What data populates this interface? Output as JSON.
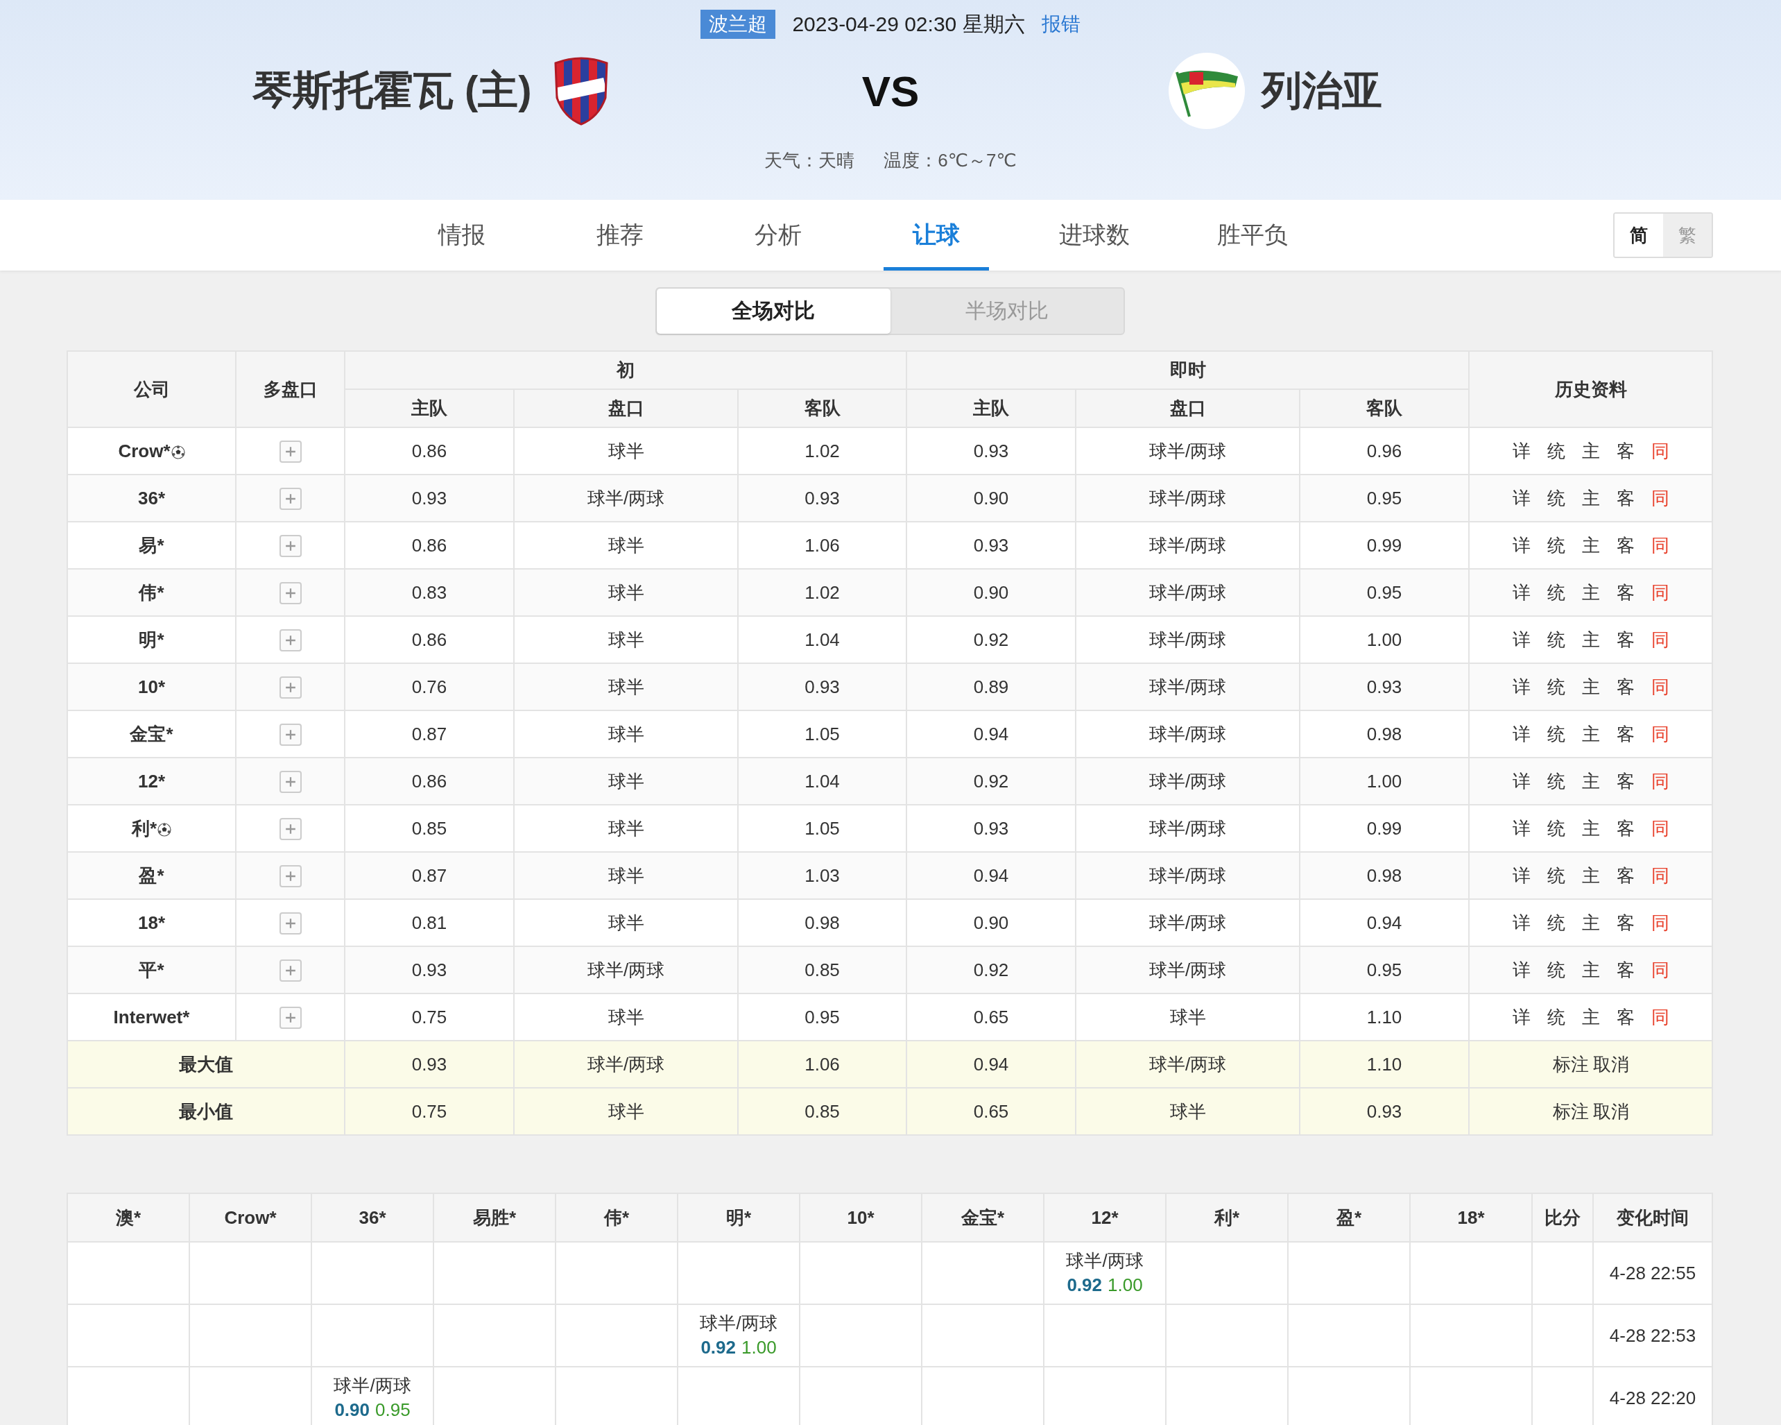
{
  "match": {
    "league": "波兰超",
    "datetime": "2023-04-29 02:30 星期六",
    "report_link": "报错",
    "home_team": "琴斯托霍瓦 (主)",
    "versus": "VS",
    "away_team": "列治亚",
    "weather": "天气：天晴",
    "temperature": "温度：6℃～7℃"
  },
  "tabs": [
    {
      "label": "情报",
      "selected": false
    },
    {
      "label": "推荐",
      "selected": false
    },
    {
      "label": "分析",
      "selected": false
    },
    {
      "label": "让球",
      "selected": true
    },
    {
      "label": "进球数",
      "selected": false
    },
    {
      "label": "胜平负",
      "selected": false
    }
  ],
  "script_toggle": [
    {
      "label": "简",
      "selected": true
    },
    {
      "label": "繁",
      "selected": false
    }
  ],
  "compare_toggle": [
    {
      "label": "全场对比",
      "selected": true
    },
    {
      "label": "半场对比",
      "selected": false
    }
  ],
  "odds_table": {
    "headers": {
      "company": "公司",
      "multi": "多盘口",
      "initial": "初",
      "live": "即时",
      "history": "历史资料",
      "sub": [
        "主队",
        "盘口",
        "客队",
        "主队",
        "盘口",
        "客队"
      ]
    },
    "rows": [
      {
        "company": "Crow*",
        "ball_icon": true,
        "values": [
          "0.86",
          "球半",
          "1.02",
          "0.93",
          "球半/两球",
          "0.96"
        ],
        "history": [
          {
            "label": "详",
            "color": "#333333"
          },
          {
            "label": "统",
            "color": "#333333"
          },
          {
            "label": "主",
            "color": "#333333"
          },
          {
            "label": "客",
            "color": "#333333"
          },
          {
            "label": "同",
            "color": "#e8412c"
          }
        ]
      },
      {
        "company": "36*",
        "ball_icon": false,
        "values": [
          "0.93",
          "球半/两球",
          "0.93",
          "0.90",
          "球半/两球",
          "0.95"
        ],
        "history": [
          {
            "label": "详",
            "color": "#333333"
          },
          {
            "label": "统",
            "color": "#333333"
          },
          {
            "label": "主",
            "color": "#333333"
          },
          {
            "label": "客",
            "color": "#333333"
          },
          {
            "label": "同",
            "color": "#e8412c"
          }
        ]
      },
      {
        "company": "易*",
        "ball_icon": false,
        "values": [
          "0.86",
          "球半",
          "1.06",
          "0.93",
          "球半/两球",
          "0.99"
        ],
        "history": [
          {
            "label": "详",
            "color": "#333333"
          },
          {
            "label": "统",
            "color": "#333333"
          },
          {
            "label": "主",
            "color": "#333333"
          },
          {
            "label": "客",
            "color": "#333333"
          },
          {
            "label": "同",
            "color": "#e8412c"
          }
        ]
      },
      {
        "company": "伟*",
        "ball_icon": false,
        "values": [
          "0.83",
          "球半",
          "1.02",
          "0.90",
          "球半/两球",
          "0.95"
        ],
        "history": [
          {
            "label": "详",
            "color": "#333333"
          },
          {
            "label": "统",
            "color": "#333333"
          },
          {
            "label": "主",
            "color": "#333333"
          },
          {
            "label": "客",
            "color": "#333333"
          },
          {
            "label": "同",
            "color": "#e8412c"
          }
        ]
      },
      {
        "company": "明*",
        "ball_icon": false,
        "values": [
          "0.86",
          "球半",
          "1.04",
          "0.92",
          "球半/两球",
          "1.00"
        ],
        "history": [
          {
            "label": "详",
            "color": "#333333"
          },
          {
            "label": "统",
            "color": "#333333"
          },
          {
            "label": "主",
            "color": "#333333"
          },
          {
            "label": "客",
            "color": "#333333"
          },
          {
            "label": "同",
            "color": "#e8412c"
          }
        ]
      },
      {
        "company": "10*",
        "ball_icon": false,
        "values": [
          "0.76",
          "球半",
          "0.93",
          "0.89",
          "球半/两球",
          "0.93"
        ],
        "history": [
          {
            "label": "详",
            "color": "#333333"
          },
          {
            "label": "统",
            "color": "#333333"
          },
          {
            "label": "主",
            "color": "#333333"
          },
          {
            "label": "客",
            "color": "#333333"
          },
          {
            "label": "同",
            "color": "#e8412c"
          }
        ]
      },
      {
        "company": "金宝*",
        "ball_icon": false,
        "values": [
          "0.87",
          "球半",
          "1.05",
          "0.94",
          "球半/两球",
          "0.98"
        ],
        "history": [
          {
            "label": "详",
            "color": "#333333"
          },
          {
            "label": "统",
            "color": "#333333"
          },
          {
            "label": "主",
            "color": "#333333"
          },
          {
            "label": "客",
            "color": "#333333"
          },
          {
            "label": "同",
            "color": "#e8412c"
          }
        ]
      },
      {
        "company": "12*",
        "ball_icon": false,
        "values": [
          "0.86",
          "球半",
          "1.04",
          "0.92",
          "球半/两球",
          "1.00"
        ],
        "history": [
          {
            "label": "详",
            "color": "#333333"
          },
          {
            "label": "统",
            "color": "#333333"
          },
          {
            "label": "主",
            "color": "#333333"
          },
          {
            "label": "客",
            "color": "#333333"
          },
          {
            "label": "同",
            "color": "#e8412c"
          }
        ]
      },
      {
        "company": "利*",
        "ball_icon": true,
        "values": [
          "0.85",
          "球半",
          "1.05",
          "0.93",
          "球半/两球",
          "0.99"
        ],
        "history": [
          {
            "label": "详",
            "color": "#333333"
          },
          {
            "label": "统",
            "color": "#333333"
          },
          {
            "label": "主",
            "color": "#333333"
          },
          {
            "label": "客",
            "color": "#333333"
          },
          {
            "label": "同",
            "color": "#e8412c"
          }
        ]
      },
      {
        "company": "盈*",
        "ball_icon": false,
        "values": [
          "0.87",
          "球半",
          "1.03",
          "0.94",
          "球半/两球",
          "0.98"
        ],
        "history": [
          {
            "label": "详",
            "color": "#333333"
          },
          {
            "label": "统",
            "color": "#333333"
          },
          {
            "label": "主",
            "color": "#333333"
          },
          {
            "label": "客",
            "color": "#333333"
          },
          {
            "label": "同",
            "color": "#e8412c"
          }
        ]
      },
      {
        "company": "18*",
        "ball_icon": false,
        "values": [
          "0.81",
          "球半",
          "0.98",
          "0.90",
          "球半/两球",
          "0.94"
        ],
        "history": [
          {
            "label": "详",
            "color": "#333333"
          },
          {
            "label": "统",
            "color": "#333333"
          },
          {
            "label": "主",
            "color": "#333333"
          },
          {
            "label": "客",
            "color": "#333333"
          },
          {
            "label": "同",
            "color": "#e8412c"
          }
        ]
      },
      {
        "company": "平*",
        "ball_icon": false,
        "values": [
          "0.93",
          "球半/两球",
          "0.85",
          "0.92",
          "球半/两球",
          "0.95"
        ],
        "history": [
          {
            "label": "详",
            "color": "#333333"
          },
          {
            "label": "统",
            "color": "#333333"
          },
          {
            "label": "主",
            "color": "#333333"
          },
          {
            "label": "客",
            "color": "#333333"
          },
          {
            "label": "同",
            "color": "#e8412c"
          }
        ]
      },
      {
        "company": "Interwet*",
        "ball_icon": false,
        "values": [
          "0.75",
          "球半",
          "0.95",
          "0.65",
          "球半",
          "1.10"
        ],
        "history": [
          {
            "label": "详",
            "color": "#333333"
          },
          {
            "label": "统",
            "color": "#333333"
          },
          {
            "label": "主",
            "color": "#333333"
          },
          {
            "label": "客",
            "color": "#333333"
          },
          {
            "label": "同",
            "color": "#e8412c"
          }
        ]
      }
    ],
    "summary": [
      {
        "label": "最大值",
        "values": [
          "0.93",
          "球半/两球",
          "1.06",
          "0.94",
          "球半/两球",
          "1.10"
        ],
        "actions": [
          "标注",
          "取消"
        ]
      },
      {
        "label": "最小值",
        "values": [
          "0.75",
          "球半",
          "0.85",
          "0.65",
          "球半",
          "0.93"
        ],
        "actions": [
          "标注",
          "取消"
        ]
      }
    ]
  },
  "change_table": {
    "columns": [
      "澳*",
      "Crow*",
      "36*",
      "易胜*",
      "伟*",
      "明*",
      "10*",
      "金宝*",
      "12*",
      "利*",
      "盈*",
      "18*",
      "比分",
      "变化时间"
    ],
    "rows": [
      {
        "cells": [
          null,
          null,
          null,
          null,
          null,
          null,
          null,
          null,
          {
            "handicap": "球半/两球",
            "home": "0.92",
            "away": "1.00"
          },
          null,
          null,
          null
        ],
        "time": "4-28 22:55"
      },
      {
        "cells": [
          null,
          null,
          null,
          null,
          null,
          {
            "handicap": "球半/两球",
            "home": "0.92",
            "away": "1.00"
          },
          null,
          null,
          null,
          null,
          null,
          null
        ],
        "time": "4-28 22:53"
      },
      {
        "cells": [
          null,
          null,
          {
            "handicap": "球半/两球",
            "home": "0.90",
            "away": "0.95"
          },
          null,
          null,
          null,
          null,
          null,
          null,
          null,
          null,
          null
        ],
        "time": "4-28 22:20"
      }
    ]
  }
}
